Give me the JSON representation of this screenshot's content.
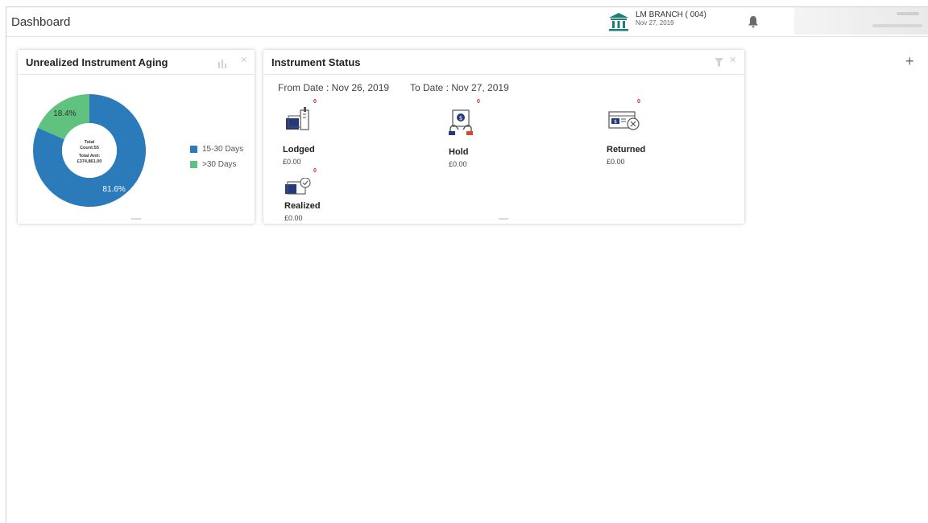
{
  "header": {
    "title": "Dashboard",
    "branch_name": "LM BRANCH  ( 004)",
    "branch_date": "Nov 27, 2019",
    "add_icon": "+"
  },
  "aging_widget": {
    "title": "Unrealized Instrument Aging",
    "center_total_count": "Total Count:55",
    "center_total_amt_label": "Total Amt:",
    "center_total_amt": "£374,861.00",
    "chart_data": {
      "type": "pie",
      "title": "Unrealized Instrument Aging",
      "categories": [
        "15-30 Days",
        ">30 Days"
      ],
      "values": [
        81.6,
        18.4
      ],
      "labels": [
        "81.6%",
        "18.4%"
      ],
      "colors": [
        "#2b7bba",
        "#5fc27e"
      ],
      "legend_position": "right",
      "donut": true
    }
  },
  "status_widget": {
    "title": "Instrument Status",
    "from_date": "From Date : Nov 26, 2019",
    "to_date": "To Date : Nov 27, 2019",
    "items": [
      {
        "label": "Lodged",
        "amount": "£0.00",
        "count": "0",
        "icon": "lodged-icon"
      },
      {
        "label": "Hold",
        "amount": "£0.00",
        "count": "0",
        "icon": "hold-icon"
      },
      {
        "label": "Returned",
        "amount": "£0.00",
        "count": "0",
        "icon": "returned-icon"
      },
      {
        "label": "Realized",
        "amount": "£0.00",
        "count": "0",
        "icon": "realized-icon"
      }
    ]
  }
}
